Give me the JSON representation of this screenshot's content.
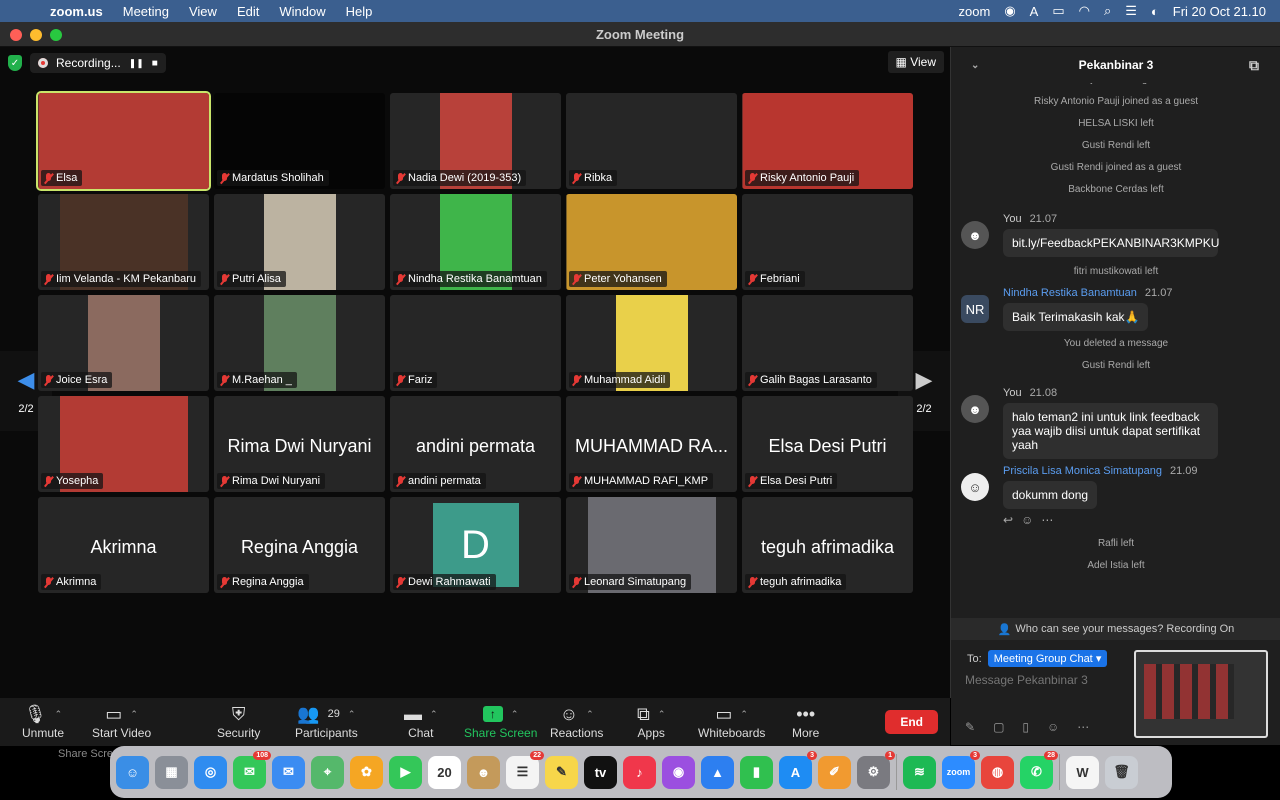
{
  "menubar": {
    "app": "zoom.us",
    "items": [
      "Meeting",
      "View",
      "Edit",
      "Window",
      "Help"
    ],
    "zoom_label": "zoom",
    "date_time": "Fri 20 Oct  21.10"
  },
  "window": {
    "title": "Zoom Meeting"
  },
  "recording": {
    "label": "Recording...",
    "pause": "❚❚",
    "stop": "■"
  },
  "view_button": "View",
  "pager": {
    "left": "2/2",
    "right": "2/2"
  },
  "tiles": [
    {
      "name": "Elsa",
      "video": "wide",
      "color": "#b33b34",
      "active": true
    },
    {
      "name": "Mardatus Sholihah",
      "video": "none",
      "color": "#050505"
    },
    {
      "name": "Nadia Dewi (2019-353)",
      "video": "narrow",
      "color": "#b8413a"
    },
    {
      "name": "Ribka",
      "video": "none"
    },
    {
      "name": "Risky Antonio Pauji",
      "video": "wide",
      "color": "#b8362f"
    },
    {
      "name": "Iim Velanda - KM Pekanbaru",
      "video": "full",
      "color": "#4a3226"
    },
    {
      "name": "Putri Alisa",
      "video": "narrow",
      "color": "#bcb3a1"
    },
    {
      "name": "Nindha Restika Banamtuan",
      "video": "narrow",
      "color": "#3fb54a"
    },
    {
      "name": "Peter Yohansen",
      "video": "wide",
      "color": "#c8952c"
    },
    {
      "name": "Febriani",
      "video": "none"
    },
    {
      "name": "Joice Esra",
      "video": "narrow",
      "color": "#8b6a5f"
    },
    {
      "name": "M.Raehan _",
      "video": "narrow",
      "color": "#5f7f5e"
    },
    {
      "name": "Fariz",
      "video": "none"
    },
    {
      "name": "Muhammad Aidil",
      "video": "narrow",
      "color": "#e9d04a"
    },
    {
      "name": "Galih Bagas Larasanto",
      "video": "none"
    },
    {
      "name": "Yosepha",
      "video": "full",
      "color": "#b33b34"
    },
    {
      "name": "Rima Dwi Nuryani",
      "big": "Rima Dwi Nuryani"
    },
    {
      "name": "andini permata",
      "big": "andini permata"
    },
    {
      "name": "MUHAMMAD RAFI_KMP",
      "big": "MUHAMMAD RA..."
    },
    {
      "name": "Elsa Desi Putri",
      "big": "Elsa Desi Putri"
    },
    {
      "name": "Akrimna",
      "big": "Akrimna"
    },
    {
      "name": "Regina Anggia",
      "big": "Regina Anggia"
    },
    {
      "name": "Dewi Rahmawati",
      "avatar": "D"
    },
    {
      "name": "Leonard Simatupang",
      "video": "full",
      "color": "#6a6a70"
    },
    {
      "name": "teguh afrimadika",
      "big": "teguh afrimadika"
    }
  ],
  "toolbar": {
    "unmute": "Unmute",
    "start_video": "Start Video",
    "security": "Security",
    "participants": "Participants",
    "participants_count": "29",
    "chat": "Chat",
    "share_screen": "Share Screen",
    "reactions": "Reactions",
    "apps": "Apps",
    "whiteboards": "Whiteboards",
    "more": "More",
    "end": "End",
    "tooltip": "Share Scre"
  },
  "chat": {
    "title": "Pekanbinar 3",
    "sys_top": [
      "Fariz joined as a guest",
      "Risky Antonio Pauji joined as a guest",
      "HELSA LISKI left",
      "Gusti Rendi left",
      "Gusti Rendi joined as a guest",
      "Backbone Cerdas left"
    ],
    "msg1": {
      "sender": "You",
      "time": "21.07",
      "text": "bit.ly/FeedbackPEKANBINAR3KMPKU"
    },
    "sys_mid1": "fitri mustikowati left",
    "msg2": {
      "sender": "Nindha Restika Banamtuan",
      "time": "21.07",
      "text": "Baik Terimakasih kak🙏",
      "initials": "NR"
    },
    "sys_mid2": [
      "You deleted a message",
      "Gusti Rendi left"
    ],
    "msg3": {
      "sender": "You",
      "time": "21.08",
      "text": "halo teman2 ini untuk link feedback yaa wajib diisi untuk dapat sertifikat yaah"
    },
    "msg4": {
      "sender": "Priscila Lisa Monica Simatupang",
      "time": "21.09",
      "text": "dokumm dong"
    },
    "sys_bottom": [
      "Rafli left",
      "Adel Istia left"
    ],
    "who_can_see": "Who can see your messages? Recording On",
    "to_label": "To:",
    "to_value": "Meeting Group Chat",
    "placeholder": "Message Pekanbinar 3"
  },
  "dock": [
    {
      "name": "finder",
      "color": "#3a8ee6",
      "glyph": "☺"
    },
    {
      "name": "launchpad",
      "color": "#8a8f98",
      "glyph": "▦"
    },
    {
      "name": "safari",
      "color": "#2f8cf0",
      "glyph": "◎"
    },
    {
      "name": "messages",
      "color": "#34c759",
      "glyph": "✉",
      "badge": "108"
    },
    {
      "name": "mail",
      "color": "#3b8cf2",
      "glyph": "✉"
    },
    {
      "name": "maps",
      "color": "#55b86b",
      "glyph": "⌖"
    },
    {
      "name": "photos",
      "color": "#f5a623",
      "glyph": "✿"
    },
    {
      "name": "facetime",
      "color": "#34c759",
      "glyph": "▶"
    },
    {
      "name": "calendar",
      "color": "#ffffff",
      "glyph": "20"
    },
    {
      "name": "contacts",
      "color": "#c49a5b",
      "glyph": "☻"
    },
    {
      "name": "reminders",
      "color": "#f4f4f4",
      "glyph": "☰",
      "badge": "22"
    },
    {
      "name": "notes",
      "color": "#f7d64a",
      "glyph": "✎"
    },
    {
      "name": "apple-tv",
      "color": "#111111",
      "glyph": "tv"
    },
    {
      "name": "music",
      "color": "#f0374b",
      "glyph": "♪"
    },
    {
      "name": "podcasts",
      "color": "#9b4fe0",
      "glyph": "◉"
    },
    {
      "name": "keynote",
      "color": "#2d7ff0",
      "glyph": "▲"
    },
    {
      "name": "numbers",
      "color": "#30c04f",
      "glyph": "▮"
    },
    {
      "name": "app-store",
      "color": "#1e8cf3",
      "glyph": "A",
      "badge": "3"
    },
    {
      "name": "pages",
      "color": "#f19a30",
      "glyph": "✐"
    },
    {
      "name": "system-settings",
      "color": "#7a7a80",
      "glyph": "⚙",
      "badge": "1"
    },
    {
      "name": "spotify",
      "color": "#1db954",
      "glyph": "≋"
    },
    {
      "name": "zoom",
      "color": "#2d8cff",
      "glyph": "zoom",
      "badge": "3"
    },
    {
      "name": "chrome",
      "color": "#e8453c",
      "glyph": "◍"
    },
    {
      "name": "whatsapp",
      "color": "#25d366",
      "glyph": "✆",
      "badge": "28"
    },
    {
      "name": "word-document",
      "color": "#f5f5f5",
      "glyph": "W"
    },
    {
      "name": "trash",
      "color": "#c9cdd3",
      "glyph": "🗑"
    }
  ]
}
